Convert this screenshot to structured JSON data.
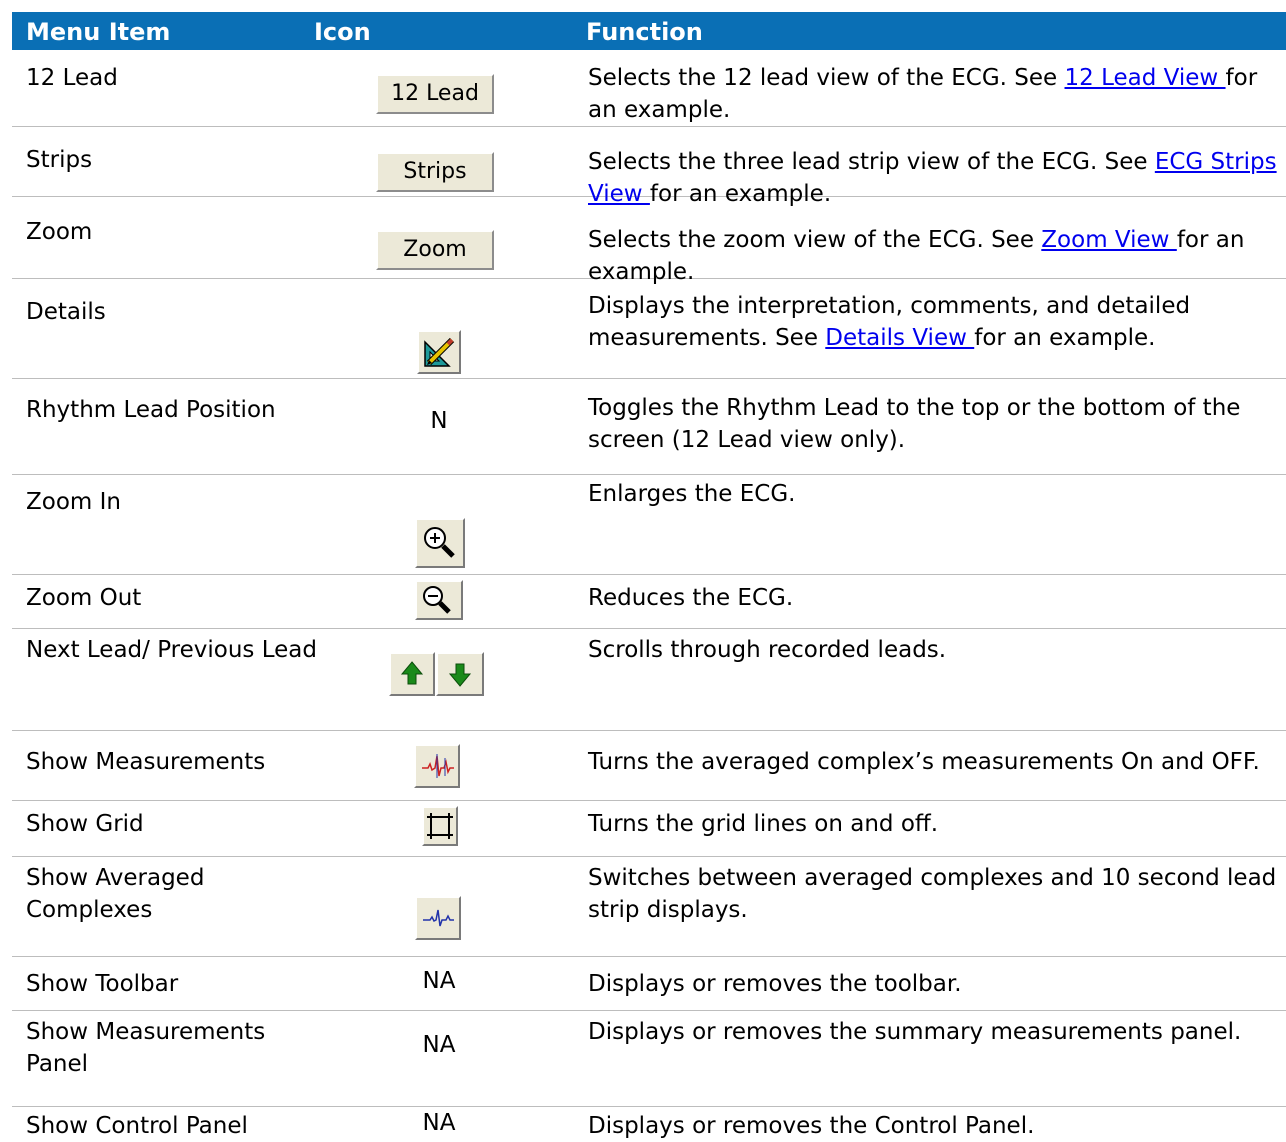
{
  "header": {
    "col_menu": "Menu Item",
    "col_icon": "Icon",
    "col_function": "Function"
  },
  "rows": [
    {
      "menu": "12 Lead",
      "icon_label": "12 Lead",
      "fn_before": "Selects the 12 lead view of the ECG. See ",
      "fn_link": "12 Lead View ",
      "fn_after": "for an example."
    },
    {
      "menu": "Strips",
      "icon_label": "Strips",
      "fn_before": "Selects the three lead strip view of the ECG. See ",
      "fn_link": "ECG Strips View ",
      "fn_after": "for an example."
    },
    {
      "menu": "Zoom",
      "icon_label": "Zoom",
      "fn_before": "Selects the zoom view of the ECG. See ",
      "fn_link": "Zoom View ",
      "fn_after": "for an example."
    },
    {
      "menu": "Details",
      "icon": "details-ruler-pencil-icon",
      "fn_before": "Displays the interpretation, comments, and detailed measurements. See ",
      "fn_link": "Details View ",
      "fn_after": "for an example."
    },
    {
      "menu": "Rhythm Lead Position",
      "icon_text": "N",
      "fn": "Toggles the Rhythm Lead to the top or the bottom of the screen (12 Lead view only)."
    },
    {
      "menu": "Zoom In",
      "icon": "zoom-in-icon",
      "fn": "Enlarges the ECG."
    },
    {
      "menu": "Zoom Out",
      "icon": "zoom-out-icon",
      "fn": "Reduces the ECG."
    },
    {
      "menu": "Next Lead/ Previous Lead",
      "icon": "up-down-arrow-icons",
      "fn": "Scrolls through recorded leads."
    },
    {
      "menu": "Show Measurements",
      "icon": "measurements-waveform-icon",
      "fn": "Turns the averaged complex’s measurements On and OFF."
    },
    {
      "menu": "Show Grid",
      "icon": "grid-icon",
      "fn": "Turns the grid lines on and off."
    },
    {
      "menu": "Show Averaged Complexes",
      "icon": "averaged-complex-icon",
      "fn": "Switches between averaged complexes and 10 second lead strip displays."
    },
    {
      "menu": "Show Toolbar",
      "icon_text": "NA",
      "fn": "Displays or removes the toolbar."
    },
    {
      "menu": "Show Measurements Panel",
      "icon_text": "NA",
      "fn": "Displays or removes the summary measurements panel."
    },
    {
      "menu": "Show Control Panel",
      "icon_text": "NA",
      "fn": "Displays or removes the Control Panel."
    }
  ],
  "colors": {
    "header_bg": "#0a6fb5",
    "link": "#0000ee",
    "button_face": "#ece9d8"
  }
}
